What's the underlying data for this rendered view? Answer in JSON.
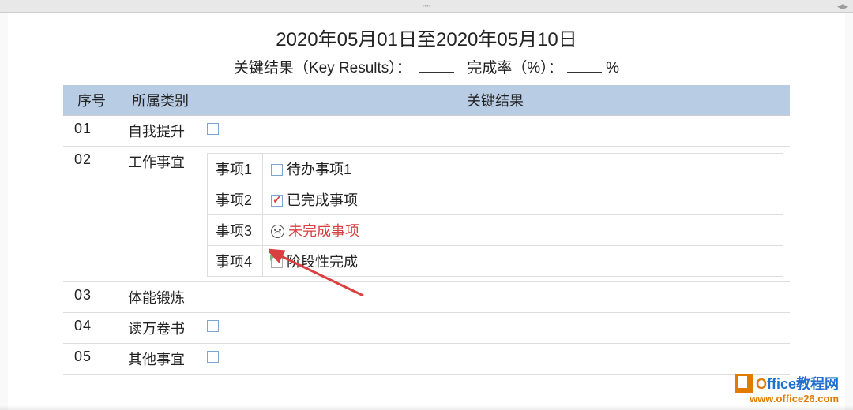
{
  "topbar": {
    "dots": "••••",
    "arrows": "◀▶"
  },
  "title": "2020年05月01日至2020年05月10日",
  "subtitle": {
    "kr_label": "关键结果（Key Results）：",
    "rate_label": "完成率（%）：",
    "percent": "%"
  },
  "headers": {
    "seq": "序号",
    "cat": "所属类别",
    "res": "关键结果"
  },
  "rows": [
    {
      "seq": "01",
      "cat": "自我提升"
    },
    {
      "seq": "02",
      "cat": "工作事宜"
    },
    {
      "seq": "03",
      "cat": "体能锻炼"
    },
    {
      "seq": "04",
      "cat": "读万卷书"
    },
    {
      "seq": "05",
      "cat": "其他事宜"
    }
  ],
  "items": [
    {
      "label": "事项1",
      "text": "待办事项1",
      "icon": "checkbox"
    },
    {
      "label": "事项2",
      "text": "已完成事项",
      "icon": "checked"
    },
    {
      "label": "事项3",
      "text": "未完成事项",
      "icon": "sad"
    },
    {
      "label": "事项4",
      "text": "阶段性完成",
      "icon": "fold"
    }
  ],
  "watermark": {
    "brand_o": "O",
    "brand_rest": "ffice教程网",
    "url": "www.office26.com"
  }
}
